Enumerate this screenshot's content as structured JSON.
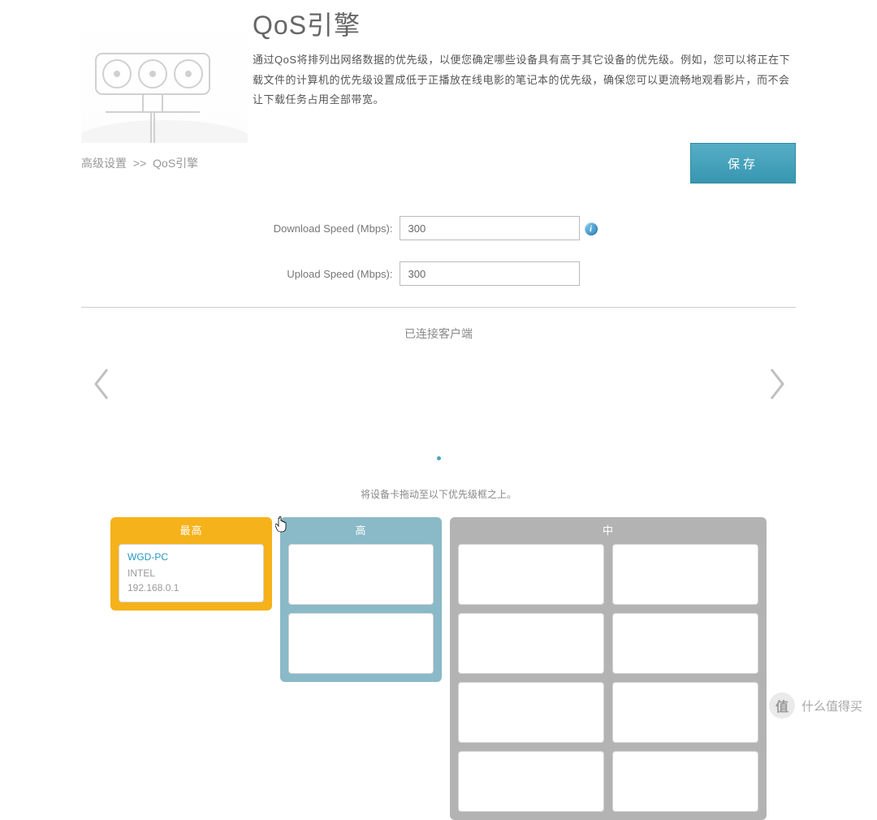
{
  "header": {
    "title": "QoS引擎",
    "description": "通过QoS将排列出网络数据的优先级，以便您确定哪些设备具有高于其它设备的优先级。例如，您可以将正在下载文件的计算机的优先级设置成低于正播放在线电影的笔记本的优先级，确保您可以更流畅地观看影片，而不会让下载任务占用全部带宽。"
  },
  "breadcrumb": {
    "root": "高级设置",
    "sep": ">>",
    "current": "QoS引擎"
  },
  "actions": {
    "save": "保存"
  },
  "speed": {
    "download_label": "Download Speed (Mbps):",
    "download_value": "300",
    "upload_label": "Upload Speed (Mbps):",
    "upload_value": "300"
  },
  "clients": {
    "title": "已连接客户端",
    "drag_hint": "将设备卡拖动至以下优先级框之上。"
  },
  "columns": {
    "highest": "最高",
    "high": "高",
    "medium": "中"
  },
  "device": {
    "name": "WGD-PC",
    "vendor": "INTEL",
    "ip": "192.168.0.1"
  },
  "watermark": {
    "badge": "值",
    "text": "什么值得买"
  }
}
